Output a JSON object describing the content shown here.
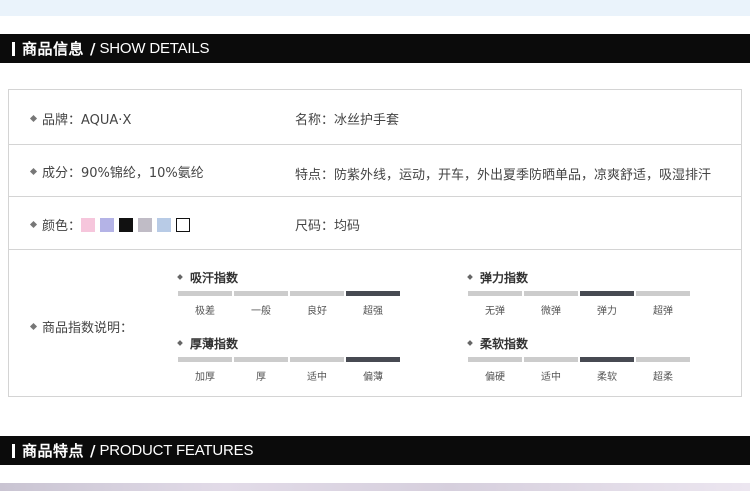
{
  "section1": {
    "cn": "商品信息",
    "slash": "/",
    "en": "SHOW DETAILS"
  },
  "section2": {
    "cn": "商品特点",
    "slash": "/",
    "en": "PRODUCT FEATURES"
  },
  "details": {
    "brand": "品牌：AQUA·X",
    "name": "名称：冰丝护手套",
    "composition": "成分：90%锦纶，10%氨纶",
    "features": "特点：防紫外线，运动，开车，外出夏季防晒单品，凉爽舒适，吸湿排汗",
    "color_label": "颜色：",
    "swatches": [
      "#f6c6dc",
      "#b4b3e6",
      "#111111",
      "#c0bcc6",
      "#b8cbe6",
      "#ffffff"
    ],
    "size": "尺码：均码",
    "index_label": "商品指数说明："
  },
  "indices": [
    {
      "title": "吸汗指数",
      "levels": [
        "极差",
        "一般",
        "良好",
        "超强"
      ],
      "selected": "超强"
    },
    {
      "title": "弹力指数",
      "levels": [
        "无弹",
        "微弹",
        "弹力",
        "超弹"
      ],
      "selected": "弹力"
    },
    {
      "title": "厚薄指数",
      "levels": [
        "加厚",
        "厚",
        "适中",
        "偏薄"
      ],
      "selected": "偏薄"
    },
    {
      "title": "柔软指数",
      "levels": [
        "偏硬",
        "适中",
        "柔软",
        "超柔"
      ],
      "selected": "柔软"
    }
  ],
  "colors": {
    "bar": "#0b0b0b",
    "border": "#d4d4d4",
    "segment_on": "#474a52",
    "segment_off": "#cccccc"
  }
}
